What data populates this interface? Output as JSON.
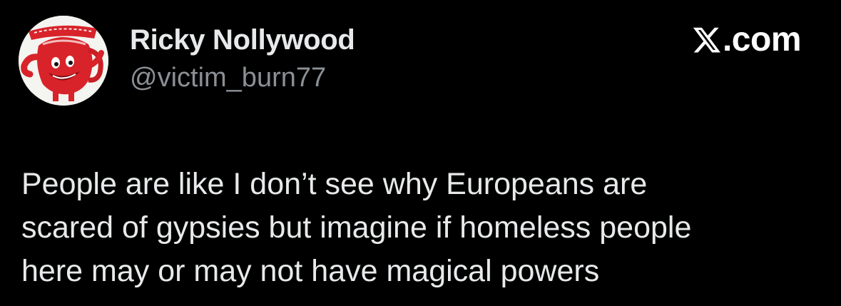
{
  "author": {
    "display_name": "Ricky Nollywood",
    "handle": "@victim_burn77",
    "avatar_icon": "kool-aid-man-avatar"
  },
  "site": {
    "logo_icon": "x-logo-icon",
    "suffix": ".com"
  },
  "tweet": {
    "lines": [
      "People are like I don’t see why Europeans are",
      "scared of gypsies but imagine if homeless people",
      "here may or may not have magical powers"
    ]
  },
  "colors": {
    "background": "#000000",
    "primary_text": "#e7e9ea",
    "secondary_text": "#8b9096",
    "avatar_red": "#d8232a"
  }
}
